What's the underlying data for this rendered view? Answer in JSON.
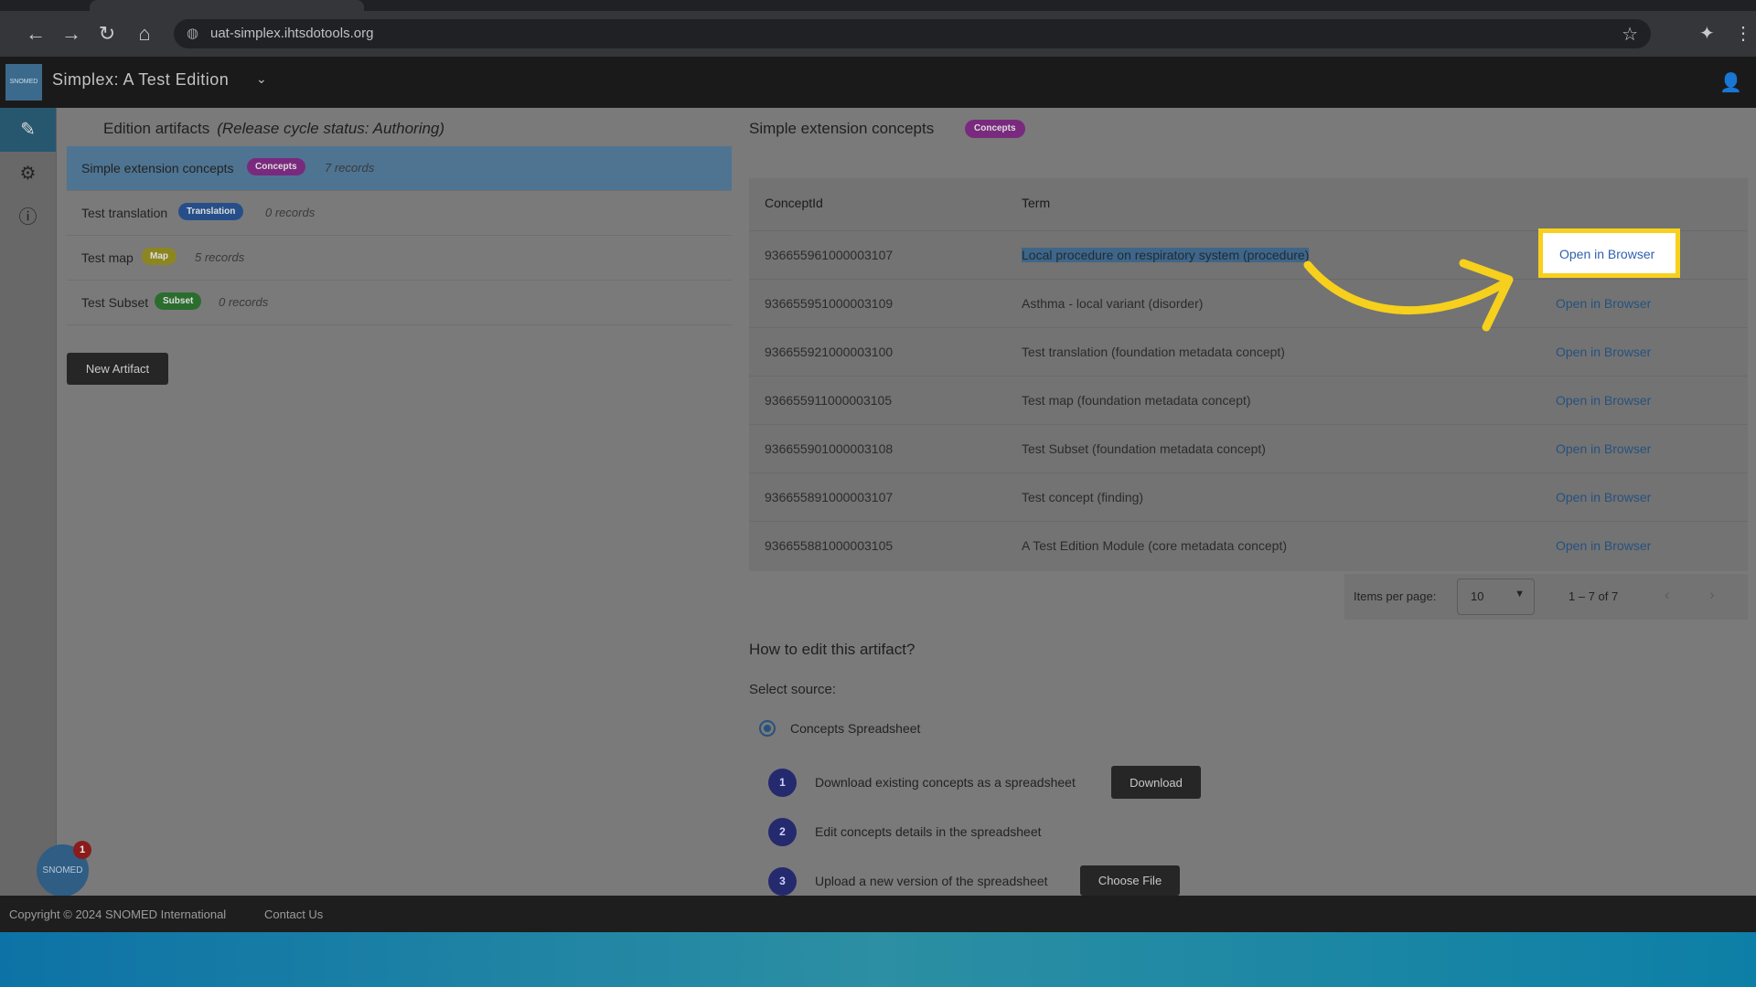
{
  "browser": {
    "url": "uat-simplex.ihtsdotools.org"
  },
  "header": {
    "logo_text": "SNOMED",
    "app_title": "Simplex: A Test Edition"
  },
  "left_panel": {
    "title": "Edition artifacts",
    "status": "(Release cycle status: Authoring)",
    "artifacts": [
      {
        "name": "Simple extension concepts",
        "badge": "Concepts",
        "count": "7 records",
        "badge_color": "#7a2a7e"
      },
      {
        "name": "Test translation",
        "badge": "Translation",
        "count": "0 records",
        "badge_color": "#264f8a"
      },
      {
        "name": "Test map",
        "badge": "Map",
        "count": "5 records",
        "badge_color": "#8c8621"
      },
      {
        "name": "Test Subset",
        "badge": "Subset",
        "count": "0 records",
        "badge_color": "#2b6d2f"
      }
    ],
    "new_artifact_label": "New Artifact"
  },
  "right_panel": {
    "title": "Simple extension concepts",
    "badge": "Concepts",
    "table": {
      "headers": [
        "ConceptId",
        "Term"
      ],
      "rows": [
        {
          "id": "936655961000003107",
          "term": "Local procedure on respiratory system (procedure)",
          "link": "Open in Browser"
        },
        {
          "id": "936655951000003109",
          "term": "Asthma - local variant (disorder)",
          "link": "Open in Browser"
        },
        {
          "id": "936655921000003100",
          "term": "Test translation (foundation metadata concept)",
          "link": "Open in Browser"
        },
        {
          "id": "936655911000003105",
          "term": "Test map (foundation metadata concept)",
          "link": "Open in Browser"
        },
        {
          "id": "936655901000003108",
          "term": "Test Subset (foundation metadata concept)",
          "link": "Open in Browser"
        },
        {
          "id": "936655891000003107",
          "term": "Test concept (finding)",
          "link": "Open in Browser"
        },
        {
          "id": "936655881000003105",
          "term": "A Test Edition Module (core metadata concept)",
          "link": "Open in Browser"
        }
      ]
    },
    "pagination": {
      "items_per_page_label": "Items per page:",
      "items_per_page": "10",
      "range": "1 – 7 of 7"
    },
    "edit": {
      "title": "How to edit this artifact?",
      "select_source_label": "Select source:",
      "source_option": "Concepts Spreadsheet",
      "steps": [
        {
          "num": "1",
          "text": "Download existing concepts as a spreadsheet",
          "button": "Download"
        },
        {
          "num": "2",
          "text": "Edit concepts details in the spreadsheet",
          "button": ""
        },
        {
          "num": "3",
          "text": "Upload a new version of the spreadsheet",
          "button": "Choose File"
        }
      ]
    }
  },
  "chat": {
    "label": "SNOMED",
    "count": "1"
  },
  "footer": {
    "copyright": "Copyright © 2024 SNOMED International",
    "contact": "Contact Us"
  },
  "colors": {
    "highlight_border": "#f6d01c",
    "accent_blue": "#27517e",
    "arrow": "#f6d01c"
  }
}
